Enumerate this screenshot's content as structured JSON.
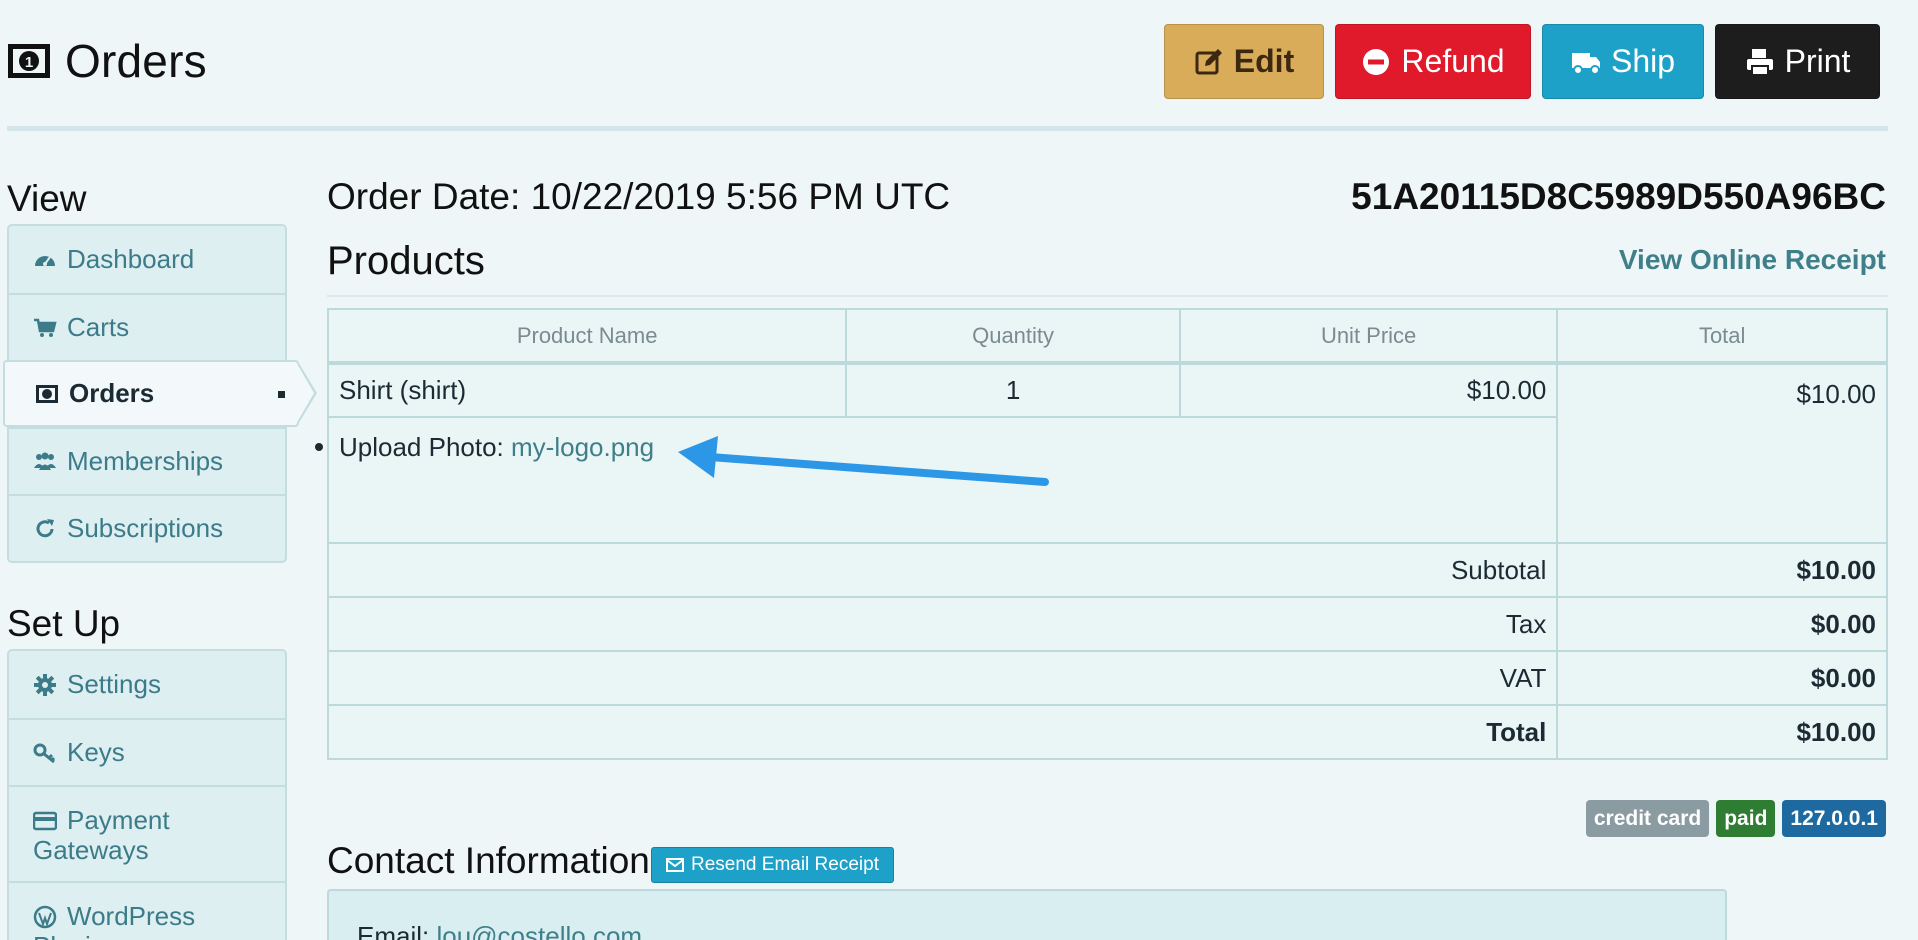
{
  "header": {
    "title": "Orders",
    "buttons": {
      "edit": "Edit",
      "refund": "Refund",
      "ship": "Ship",
      "print": "Print"
    },
    "colors": {
      "edit": "#d9ac5a",
      "refund": "#e01a2b",
      "ship": "#1ea1c8",
      "print": "#1d1d1d"
    }
  },
  "sidebar": {
    "view_title": "View",
    "view_items": [
      {
        "label": "Dashboard",
        "icon": "dashboard-icon"
      },
      {
        "label": "Carts",
        "icon": "cart-icon"
      },
      {
        "label": "Orders",
        "icon": "orders-icon",
        "active": true
      },
      {
        "label": "Memberships",
        "icon": "users-icon"
      },
      {
        "label": "Subscriptions",
        "icon": "refresh-icon"
      }
    ],
    "setup_title": "Set Up",
    "setup_items": [
      {
        "label": "Settings",
        "icon": "gear-icon"
      },
      {
        "label": "Keys",
        "icon": "key-icon"
      },
      {
        "label_line1": "Payment",
        "label_line2": "Gateways",
        "icon": "credit-card-icon"
      },
      {
        "label_line1": "WordPress",
        "label_line2": "Plugin",
        "icon": "wordpress-icon"
      }
    ]
  },
  "order": {
    "date_label": "Order Date: 10/22/2019 5:56 PM UTC",
    "id": "51A20115D8C5989D550A96BC",
    "products_title": "Products",
    "receipt_link": "View Online Receipt",
    "table": {
      "headers": [
        "Product Name",
        "Quantity",
        "Unit Price",
        "Total"
      ],
      "rows": [
        {
          "name": "Shirt (shirt)",
          "quantity": "1",
          "unit_price": "$10.00",
          "total": "$10.00"
        }
      ],
      "option_label": "Upload Photo: ",
      "option_value": "my-logo.png",
      "summary": [
        {
          "label": "Subtotal",
          "value": "$10.00"
        },
        {
          "label": "Tax",
          "value": "$0.00"
        },
        {
          "label": "VAT",
          "value": "$0.00"
        },
        {
          "label": "Total",
          "value": "$10.00"
        }
      ]
    },
    "badges": [
      {
        "text": "credit card",
        "color": "#8a9ba1"
      },
      {
        "text": "paid",
        "color": "#2e7d32"
      },
      {
        "text": "127.0.0.1",
        "color": "#1e6aa0"
      }
    ]
  },
  "contact": {
    "title": "Contact Information",
    "resend_label": "Resend Email Receipt",
    "email_label": "Email: ",
    "email_value": "lou@costello.com"
  },
  "annotation": {
    "arrow_color": "#2b97e6"
  }
}
